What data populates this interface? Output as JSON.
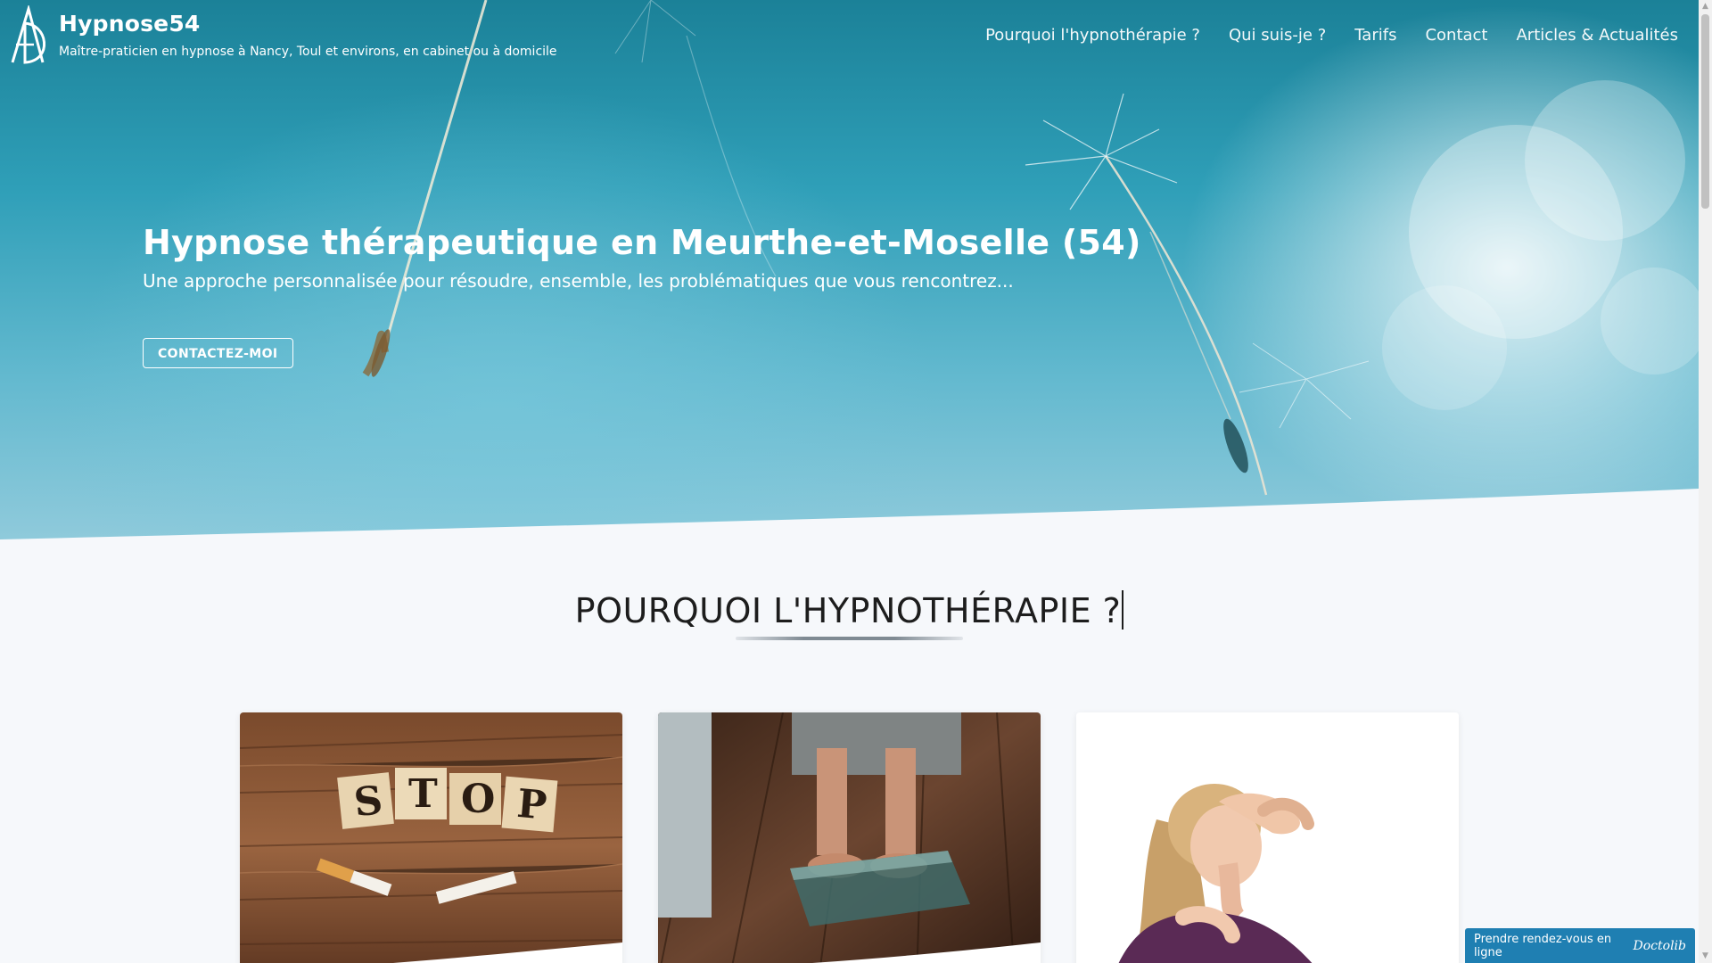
{
  "header": {
    "brand_name": "Hypnose54",
    "tagline": "Maître-praticien en hypnose à Nancy, Toul et environs, en cabinet ou à domicile",
    "logo_icon": "ad-monogram-logo",
    "nav": [
      {
        "label": "Pourquoi l'hypnothérapie ?"
      },
      {
        "label": "Qui suis-je ?"
      },
      {
        "label": "Tarifs"
      },
      {
        "label": "Contact"
      },
      {
        "label": "Articles & Actualités"
      }
    ]
  },
  "hero": {
    "title": "Hypnose thérapeutique en Meurthe-et-Moselle (54)",
    "subtitle": "Une approche personnalisée pour résoudre, ensemble, les problématiques que vous rencontrez...",
    "cta_label": "CONTACTEZ-MOI"
  },
  "section": {
    "title": "POURQUOI L'HYPNOTHÉRAPIE ?"
  },
  "cards": [
    {
      "image": "stop-smoking-photo",
      "tile_letters": [
        "S",
        "T",
        "O",
        "P"
      ]
    },
    {
      "image": "bathroom-scale-photo"
    },
    {
      "image": "stress-headache-photo"
    }
  ],
  "booking": {
    "label": "Prendre rendez-vous en ligne",
    "logo": "Doctolib"
  },
  "colors": {
    "hero_top": "#1b8198",
    "hero_bottom": "#8fcadb",
    "page_background": "#f6f8fb",
    "booking_blue": "#1f7fb2"
  }
}
